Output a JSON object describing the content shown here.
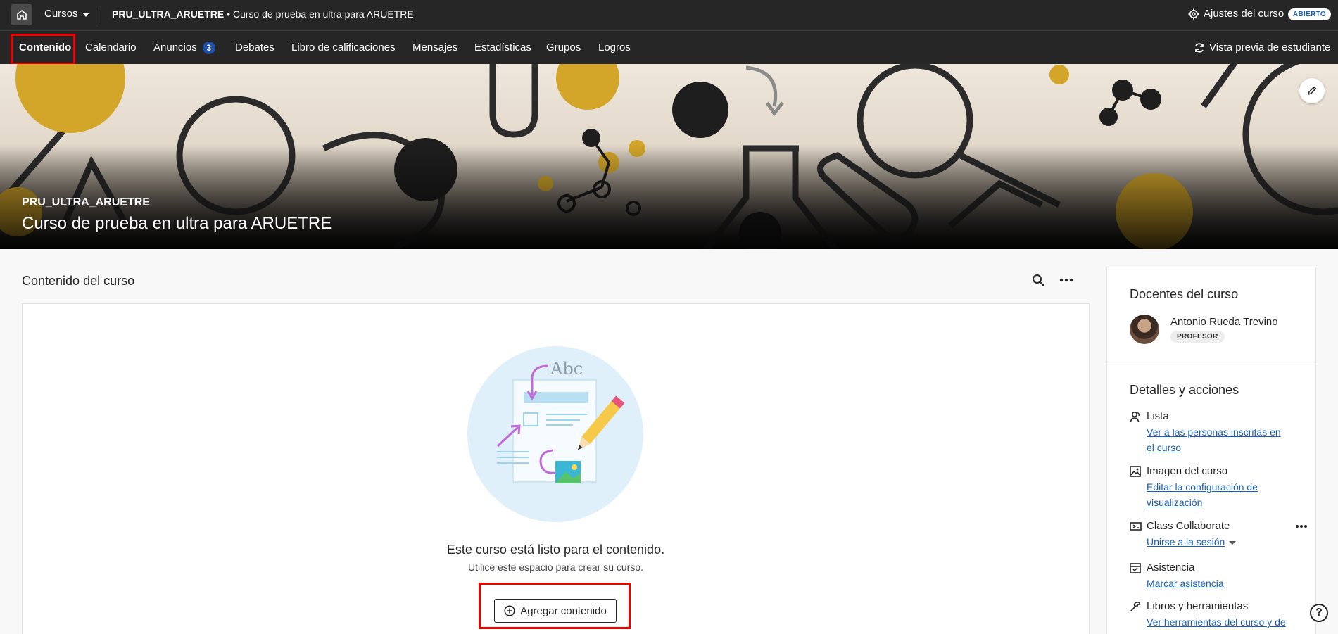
{
  "topbar": {
    "courses_label": "Cursos",
    "course_code": "PRU_ULTRA_ARUETRE",
    "course_name_suffix": " • Curso de prueba en ultra para ARUETRE",
    "settings_label": "Ajustes del curso",
    "status_badge": "ABIERTO"
  },
  "nav": {
    "items": [
      {
        "label": "Contenido"
      },
      {
        "label": "Calendario"
      },
      {
        "label": "Anuncios",
        "count": "3"
      },
      {
        "label": "Debates"
      },
      {
        "label": "Libro de calificaciones"
      },
      {
        "label": "Mensajes"
      },
      {
        "label": "Estadísticas"
      },
      {
        "label": "Grupos"
      },
      {
        "label": "Logros"
      }
    ],
    "student_preview_label": "Vista previa de estudiante"
  },
  "banner": {
    "code": "PRU_ULTRA_ARUETRE",
    "title": "Curso de prueba en ultra para ARUETRE"
  },
  "content": {
    "section_title": "Contenido del curso",
    "empty_title": "Este curso está listo para el contenido.",
    "empty_subtitle": "Utilice este espacio para crear su curso.",
    "add_content_label": "Agregar contenido",
    "illustration_text": "Abc"
  },
  "sidebar": {
    "teachers_heading": "Docentes del curso",
    "teacher_name": "Antonio Rueda Trevino",
    "teacher_role": "PROFESOR",
    "details_heading": "Detalles y acciones",
    "details": [
      {
        "icon": "roster-icon",
        "title": "Lista",
        "link": "Ver a las personas inscritas en el curso"
      },
      {
        "icon": "image-icon",
        "title": "Imagen del curso",
        "link": "Editar la configuración de visualización"
      },
      {
        "icon": "collaborate-icon",
        "title": "Class Collaborate",
        "link": "Unirse a la sesión"
      },
      {
        "icon": "attendance-icon",
        "title": "Asistencia",
        "link": "Marcar asistencia"
      },
      {
        "icon": "tools-icon",
        "title": "Libros y herramientas",
        "link": "Ver herramientas del curso y de la institución"
      }
    ]
  },
  "colors": {
    "topbar_bg": "#262626",
    "link": "#1a5fb4",
    "highlight_box": "#e00000",
    "badge_blue": "#1e4fa8"
  }
}
